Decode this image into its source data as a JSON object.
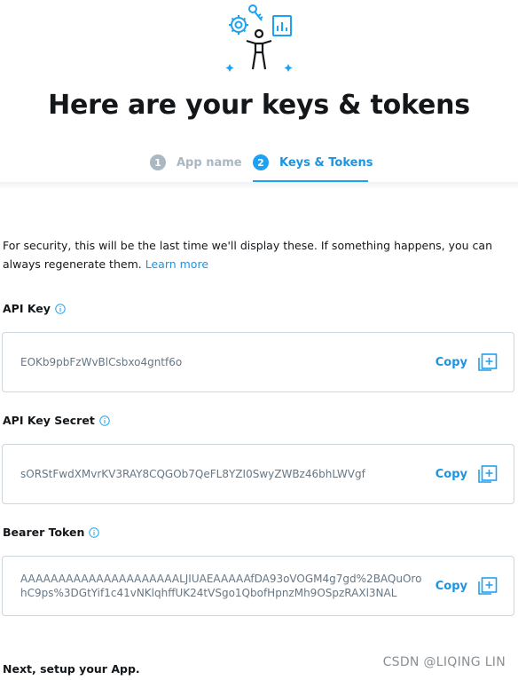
{
  "header": {
    "title": "Here are your keys & tokens",
    "illustration_icon": "developer-keys-illustration-icon"
  },
  "steps": [
    {
      "number": "1",
      "label": "App name",
      "state": "completed"
    },
    {
      "number": "2",
      "label": "Keys & Tokens",
      "state": "active"
    }
  ],
  "notice": {
    "text": "For security, this will be the last time we'll display these. If something happens, you can always regenerate them.",
    "link_label": "Learn more"
  },
  "fields": [
    {
      "label": "API Key",
      "value": "EOKb9pbFzWvBlCsbxo4gntf6o",
      "copy_label": "Copy"
    },
    {
      "label": "API Key Secret",
      "value": "sORStFwdXMvrKV3RAY8CQGOb7QeFL8YZI0SwyZWBz46bhLWVgf",
      "copy_label": "Copy"
    },
    {
      "label": "Bearer Token",
      "value": "AAAAAAAAAAAAAAAAAAAAALJIUAEAAAAAfDA93oVOGM4g7gd%2BAQuOrohC9ps%3DGtYif1c41vNKlqhffUK24tVSgo1QbofHpnzMh9OSpzRAXl3NAL",
      "copy_label": "Copy"
    }
  ],
  "next_section": {
    "title": "Next, setup your App."
  },
  "watermark": "CSDN @LIQING LIN",
  "colors": {
    "accent": "#1da1f2",
    "link": "#1b95e0",
    "muted": "#aab8c2",
    "text": "#14171a",
    "border": "#ccd6dd"
  }
}
